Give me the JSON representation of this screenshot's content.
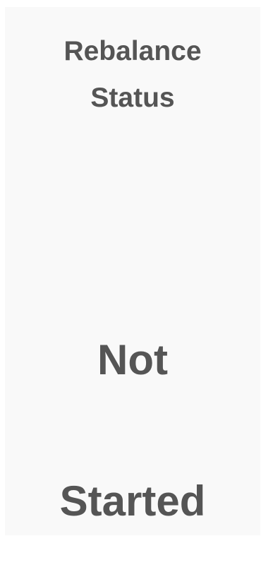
{
  "widget": {
    "title_line1": "Rebalance",
    "title_line2": "Status",
    "status_line1": "Not",
    "status_line2": "Started",
    "text_color": "#555555",
    "background_color": "#f9f9f9"
  }
}
